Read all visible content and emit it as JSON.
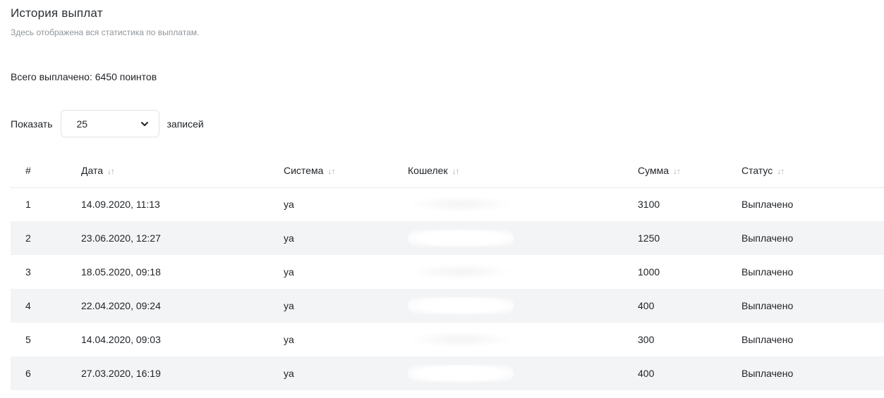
{
  "header": {
    "title": "История выплат",
    "subtitle": "Здесь отображена вся статистика по выплатам."
  },
  "summary": {
    "total_text": "Всего выплачено: 6450 поинтов"
  },
  "length_menu": {
    "show_label": "Показать",
    "selected_value": "25",
    "records_label": "записей"
  },
  "table": {
    "columns": {
      "num": "#",
      "date": "Дата",
      "system": "Система",
      "wallet": "Кошелек",
      "sum": "Сумма",
      "status": "Статус"
    },
    "sort_glyph": "↓↑",
    "rows": [
      {
        "num": "1",
        "date": "14.09.2020, 11:13",
        "system": "ya",
        "sum": "3100",
        "status": "Выплачено"
      },
      {
        "num": "2",
        "date": "23.06.2020, 12:27",
        "system": "ya",
        "sum": "1250",
        "status": "Выплачено"
      },
      {
        "num": "3",
        "date": "18.05.2020, 09:18",
        "system": "ya",
        "sum": "1000",
        "status": "Выплачено"
      },
      {
        "num": "4",
        "date": "22.04.2020, 09:24",
        "system": "ya",
        "sum": "400",
        "status": "Выплачено"
      },
      {
        "num": "5",
        "date": "14.04.2020, 09:03",
        "system": "ya",
        "sum": "300",
        "status": "Выплачено"
      },
      {
        "num": "6",
        "date": "27.03.2020, 16:19",
        "system": "ya",
        "sum": "400",
        "status": "Выплачено"
      }
    ]
  },
  "colors": {
    "status_paid": "#4cc26a",
    "stripe": "#f3f4f6",
    "muted_text": "#8f959b"
  }
}
